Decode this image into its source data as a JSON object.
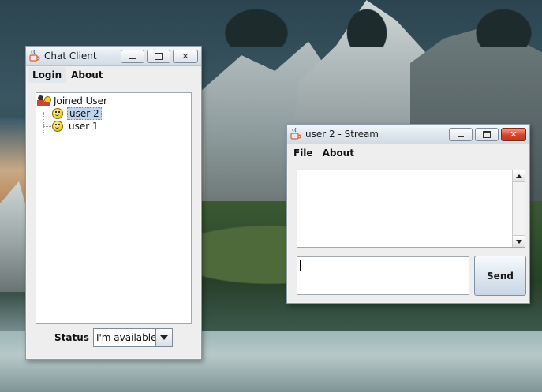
{
  "chat_client": {
    "title": "Chat Client",
    "menu": [
      "Login",
      "About"
    ],
    "tree": {
      "root_label": "Joined User",
      "users": [
        "user 2",
        "user 1"
      ],
      "selected": "user 2"
    },
    "status": {
      "label": "Status",
      "value": "I'm available"
    }
  },
  "stream_window": {
    "title": "user 2 - Stream",
    "menu": [
      "File",
      "About"
    ],
    "send_label": "Send",
    "message_value": ""
  },
  "icons": {
    "app": "java-coffee-icon",
    "user": "smiley-icon",
    "group": "users-group-icon"
  },
  "colors": {
    "selection": "#bcd4ee",
    "close_button_active": "#d5432a"
  }
}
